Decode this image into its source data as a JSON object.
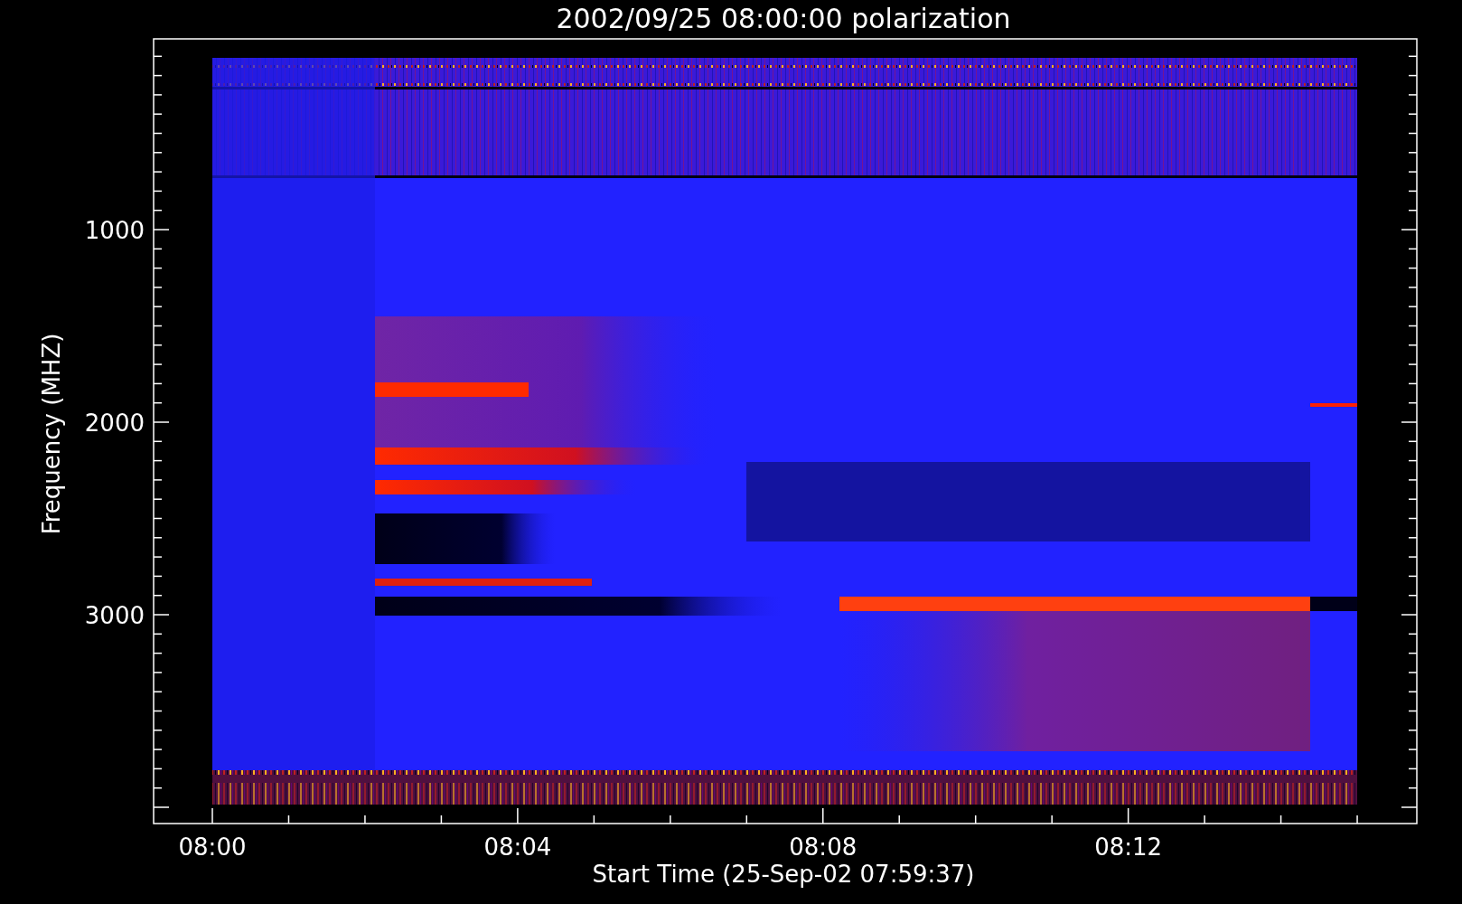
{
  "title": "2002/09/25 08:00:00 polarization",
  "y_axis": {
    "label": "Frequency (MHZ)",
    "ticks": [
      "1000",
      "2000",
      "3000"
    ]
  },
  "x_axis": {
    "label": "Start Time (25-Sep-02 07:59:37)",
    "ticks": [
      "08:00",
      "08:04",
      "08:08",
      "08:12"
    ]
  }
}
